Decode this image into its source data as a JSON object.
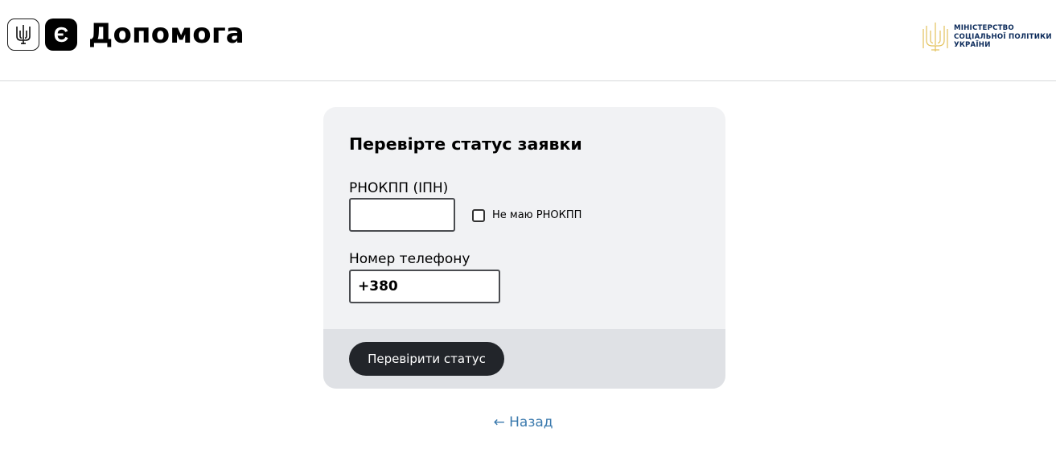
{
  "header": {
    "brand_icon": "e-letter-icon",
    "brand_letter": "Є",
    "brand_title": "Допомога",
    "ministry": {
      "line1": "Міністерство",
      "line2": "соціальної політики",
      "line3": "України"
    }
  },
  "form": {
    "title": "Перевірте статус заявки",
    "inn_label": "РНОКПП (ІПН)",
    "inn_value": "",
    "no_inn_checkbox_label": "Не маю РНОКПП",
    "no_inn_checked": false,
    "phone_label": "Номер телефону",
    "phone_value": "+380",
    "submit_label": "Перевірити статус"
  },
  "back_link": "← Назад",
  "colors": {
    "button_bg": "#22252a",
    "card_bg": "#f1f2f4",
    "card_footer_bg": "#dfe1e5",
    "link": "#3a79ad",
    "ministry_text": "#0b2a5a",
    "ministry_emblem": "#e3c25c"
  }
}
